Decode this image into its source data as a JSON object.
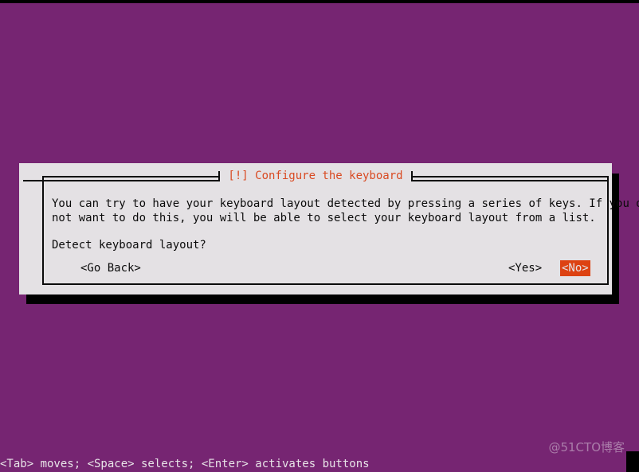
{
  "screen": {
    "background_color": "#762572",
    "foreground_color": "#e8e5e8"
  },
  "dialog": {
    "title": "[!] Configure the keyboard",
    "title_color": "#d94a22",
    "background_color": "#e4e1e4",
    "border_color": "#0b0b0b",
    "body_line_1": "You can try to have your keyboard layout detected by pressing a series of keys. If you do",
    "body_line_2": "not want to do this, you will be able to select your keyboard layout from a list.",
    "question": "Detect keyboard layout?",
    "buttons": [
      {
        "label": "<Go Back>",
        "selected": false
      },
      {
        "label": "<Yes>",
        "selected": false
      },
      {
        "label": "<No>",
        "selected": true
      }
    ],
    "selected_button_bg": "#dd4212",
    "selected_button_fg": "#e4e1e4"
  },
  "footer": {
    "help": "<Tab> moves; <Space> selects; <Enter> activates buttons"
  },
  "watermark": {
    "text": "@51CTO博客"
  }
}
